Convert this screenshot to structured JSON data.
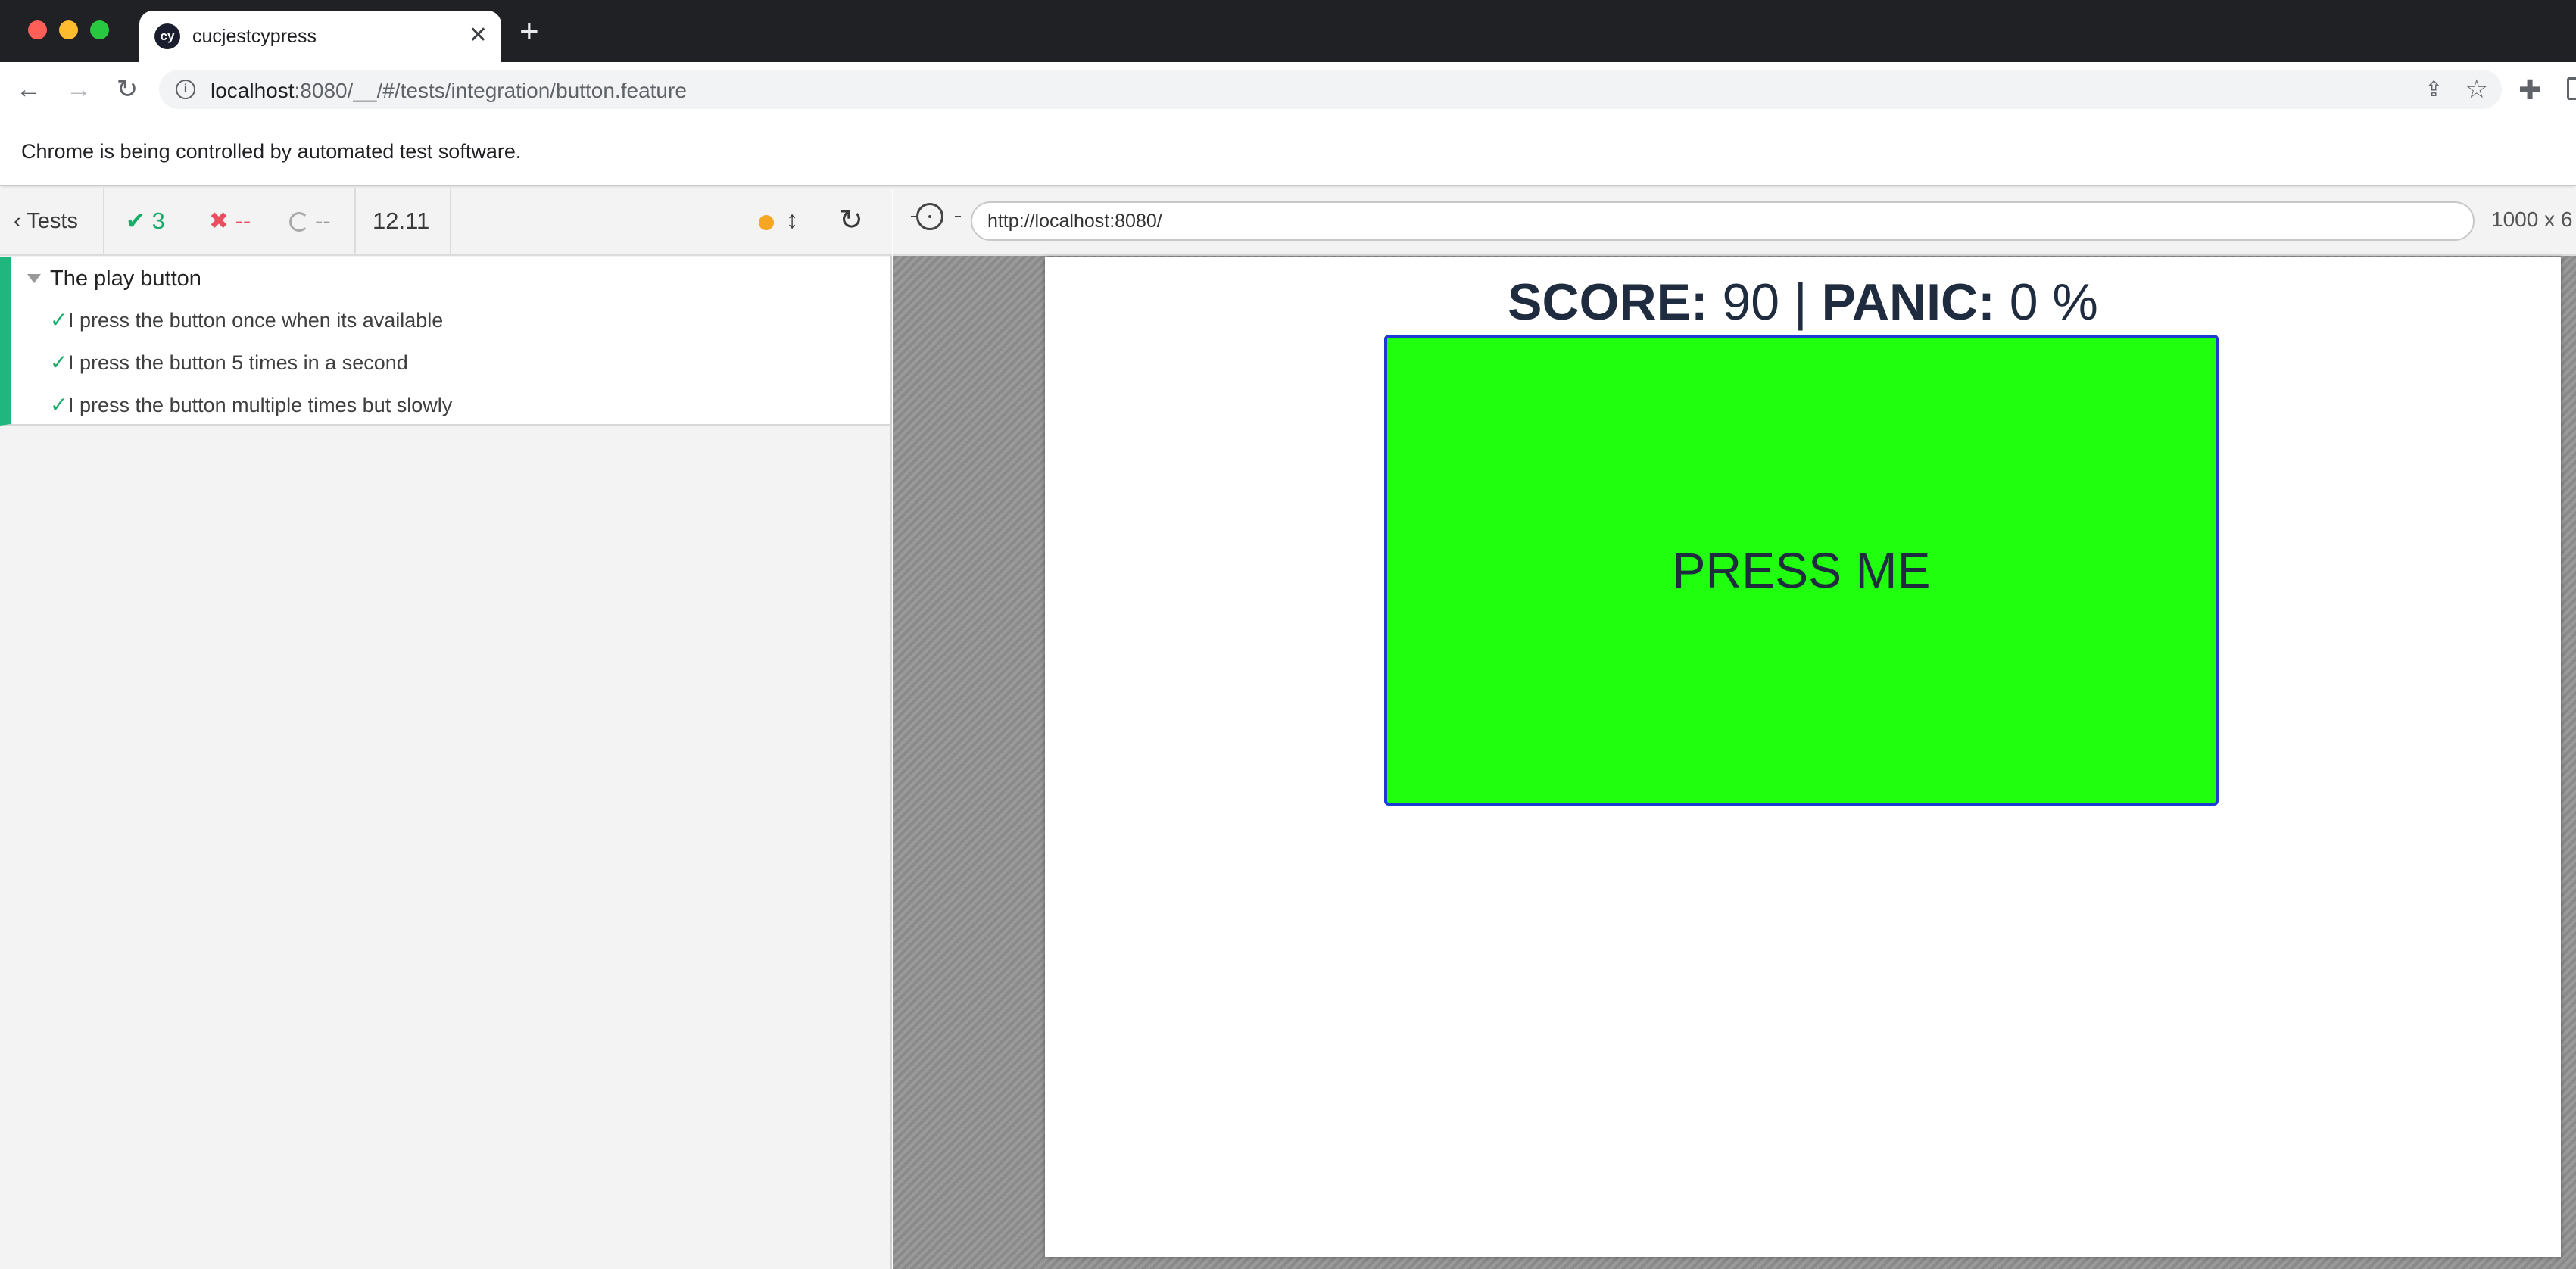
{
  "browser": {
    "tab_title": "cucjestcypress",
    "favicon_text": "cy",
    "url_host": "localhost",
    "url_rest": ":8080/__/#/tests/integration/button.feature",
    "infobar_text": "Chrome is being controlled by automated test software."
  },
  "reporter": {
    "tests_label": "Tests",
    "passed": "3",
    "failed": "--",
    "pending": "--",
    "duration": "12.11",
    "suite_title": "The play button",
    "tests": [
      {
        "title": "I press the button once when its available",
        "status": "passed"
      },
      {
        "title": "I press the button 5 times in a second",
        "status": "passed"
      },
      {
        "title": "I press the button multiple times but slowly",
        "status": "passed"
      }
    ]
  },
  "aut": {
    "url": "http://localhost:8080/",
    "viewport_size": "1000 x 6"
  },
  "app": {
    "score_label": "SCORE:",
    "score_value": "90",
    "separator": "|",
    "panic_label": "PANIC:",
    "panic_value": "0 %",
    "button_label": "PRESS ME"
  },
  "colors": {
    "button_green": "#1fff0e",
    "pass_green": "#1aab6b",
    "fail_red": "#e94f5f",
    "status_dot": "#f5a623"
  }
}
